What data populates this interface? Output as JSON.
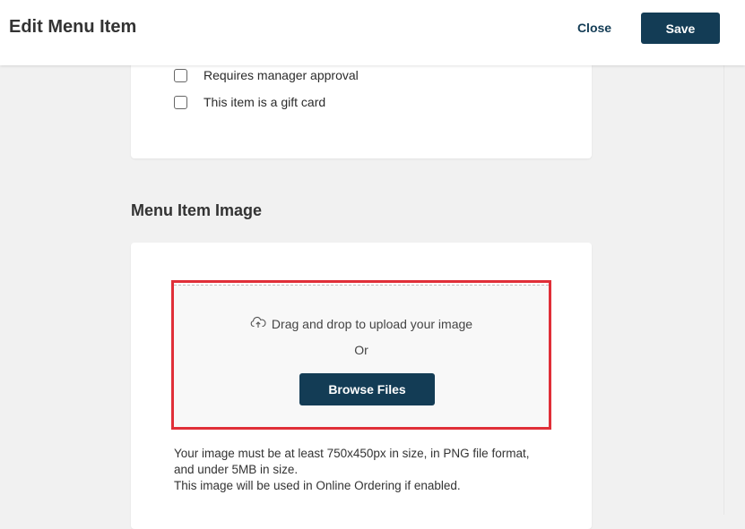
{
  "header": {
    "title": "Edit Menu Item",
    "close_label": "Close",
    "save_label": "Save"
  },
  "options": {
    "items": [
      {
        "label": "Requires manager approval",
        "checked": false
      },
      {
        "label": "This item is a gift card",
        "checked": false
      }
    ]
  },
  "image_section": {
    "heading": "Menu Item Image",
    "drag_text": "Drag and drop to upload your image",
    "or_text": "Or",
    "browse_label": "Browse Files",
    "help_line1": "Your image must be at least 750x450px in size, in PNG file format, and under 5MB in size.",
    "help_line2": "This image will be used in Online Ordering if enabled."
  },
  "colors": {
    "primary": "#133c55",
    "highlight": "#e02f38",
    "background": "#f1f1f1"
  }
}
